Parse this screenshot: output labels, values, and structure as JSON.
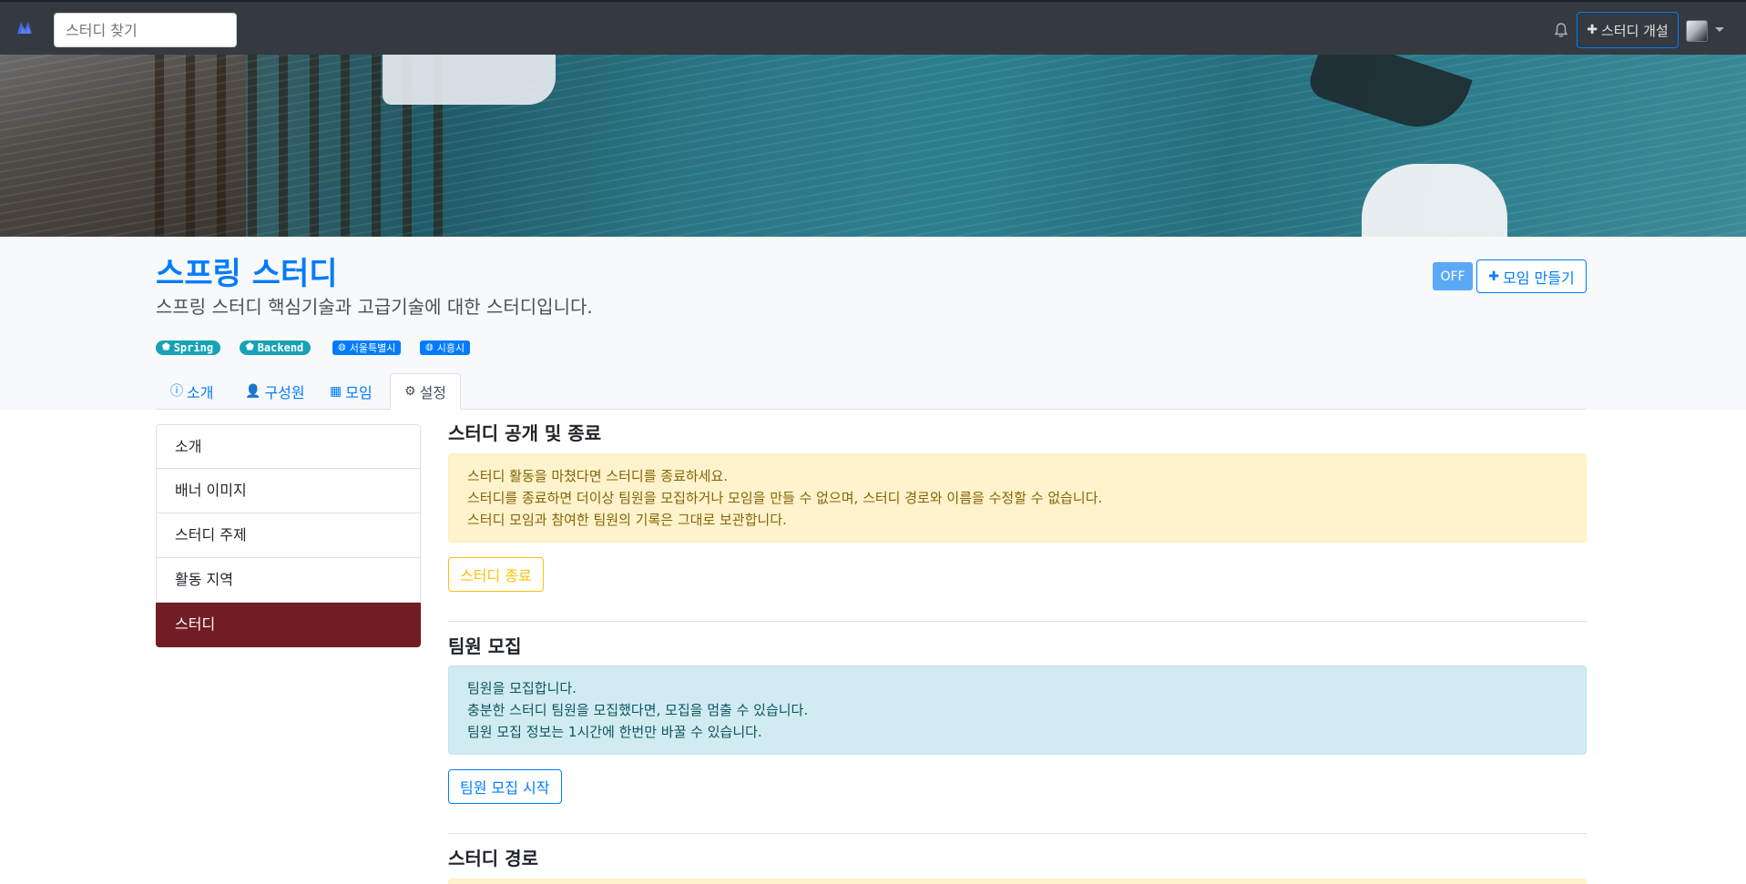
{
  "navbar": {
    "search_placeholder": "스터디 찾기",
    "open_study_label": "스터디 개설"
  },
  "study": {
    "title": "스프링 스터디",
    "description": "스프링 스터디 핵심기술과 고급기술에 대한 스터디입니다.",
    "publish_state": "OFF",
    "create_meeting_label": "모임 만들기",
    "tags": [
      "Spring",
      "Backend"
    ],
    "zones": [
      "서울특별시",
      "시흥시"
    ]
  },
  "tabs": [
    {
      "label": "소개",
      "icon": "info-icon"
    },
    {
      "label": "구성원",
      "icon": "user-icon"
    },
    {
      "label": "모임",
      "icon": "calendar-icon"
    },
    {
      "label": "설정",
      "icon": "gear-icon",
      "active": true
    }
  ],
  "settings_menu": [
    {
      "label": "소개"
    },
    {
      "label": "배너 이미지"
    },
    {
      "label": "스터디 주제"
    },
    {
      "label": "활동 지역"
    },
    {
      "label": "스터디",
      "active": true
    }
  ],
  "sections": {
    "close": {
      "title": "스터디 공개 및 종료",
      "lines": [
        "스터디 활동을 마쳤다면 스터디를 종료하세요.",
        "스터디를 종료하면 더이상 팀원을 모집하거나 모임을 만들 수 없으며, 스터디 경로와 이름을 수정할 수 없습니다.",
        "스터디 모임과 참여한 팀원의 기록은 그대로 보관합니다."
      ],
      "button": "스터디 종료"
    },
    "recruit": {
      "title": "팀원 모집",
      "lines": [
        "팀원을 모집합니다.",
        "충분한 스터디 팀원을 모집했다면, 모집을 멈출 수 있습니다.",
        "팀원 모집 정보는 1시간에 한번만 바꿀 수 있습니다."
      ],
      "button": "팀원 모집 시작"
    },
    "path": {
      "title": "스터디 경로"
    }
  },
  "colors": {
    "navbar": "#343a40",
    "primary": "#007bff",
    "info_tag": "#17a2b8",
    "menu_active": "#721c24",
    "warning_bg": "#fff3cd",
    "info_bg": "#d1ecf1"
  }
}
